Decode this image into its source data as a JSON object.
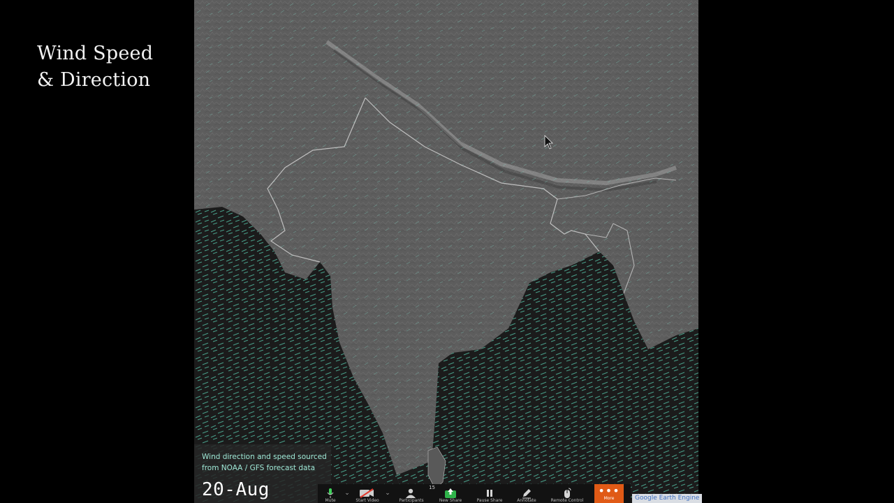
{
  "slide": {
    "title_line1": "Wind Speed",
    "title_line2": "& Direction"
  },
  "map": {
    "land_color": "#5d5d5d",
    "ocean_color": "#1a1a1a",
    "wind_color": "#5fe0c0",
    "border_color": "#d8d8d8"
  },
  "caption": {
    "text": "Wind direction and speed sourced from NOAA / GFS forecast data",
    "date": "20-Aug"
  },
  "zoom_toolbar": {
    "items": [
      {
        "label": "Mute",
        "icon": "microphone-icon"
      },
      {
        "label": "Start Video",
        "icon": "video-off-icon"
      },
      {
        "label": "Participants",
        "icon": "participants-icon",
        "count": "15"
      },
      {
        "label": "New Share",
        "icon": "share-icon"
      },
      {
        "label": "Pause Share",
        "icon": "pause-icon"
      },
      {
        "label": "Annotate",
        "icon": "pencil-icon"
      },
      {
        "label": "Remote Control",
        "icon": "mouse-icon"
      },
      {
        "label": "More",
        "icon": "more-icon"
      }
    ],
    "accent": "#e05a16"
  },
  "attribution": "Google Earth Engine"
}
